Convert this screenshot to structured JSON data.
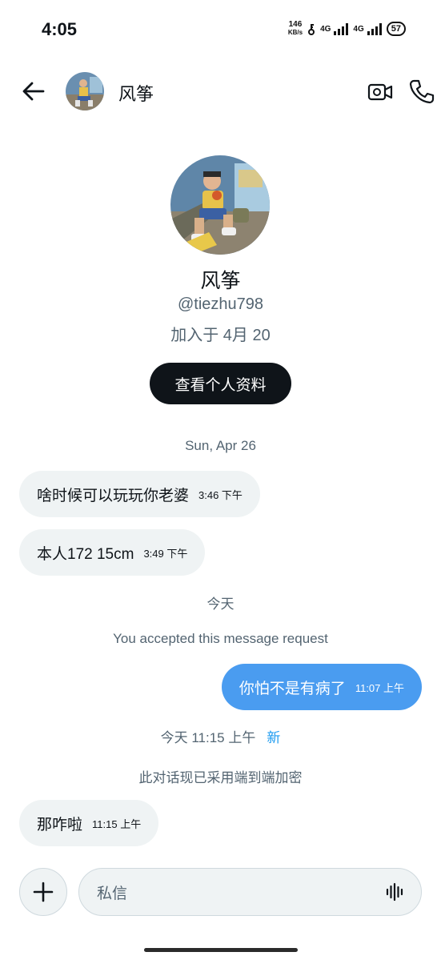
{
  "status_bar": {
    "time": "4:05",
    "net_speed_value": "146",
    "net_speed_unit": "KB/s",
    "network_label_1": "4G",
    "network_label_2": "4G",
    "battery": "57"
  },
  "header": {
    "name": "风筝"
  },
  "profile": {
    "name": "风筝",
    "handle": "@tiezhu798",
    "joined": "加入于 4月 20",
    "view_profile_label": "查看个人资料"
  },
  "conversation": {
    "date_separator_1": "Sun, Apr 26",
    "messages_1": [
      {
        "text": "啥时候可以玩玩你老婆",
        "time": "3:46 下午"
      },
      {
        "text": "本人172 15cm",
        "time": "3:49 下午"
      }
    ],
    "date_separator_2": "今天",
    "accepted_note": "You accepted this message request",
    "outgoing": {
      "text": "你怕不是有病了",
      "time": "11:07 上午"
    },
    "new_separator_time": "今天 11:15 上午",
    "new_label": "新",
    "encryption_note": "此对话现已采用端到端加密",
    "messages_2": [
      {
        "text": "那咋啦",
        "time": "11:15 上午"
      }
    ]
  },
  "composer": {
    "placeholder": "私信"
  },
  "colors": {
    "outgoing_bubble": "#4a9cf0",
    "incoming_bubble": "#eff3f4",
    "link": "#1d9bf0",
    "secondary_text": "#536471"
  }
}
